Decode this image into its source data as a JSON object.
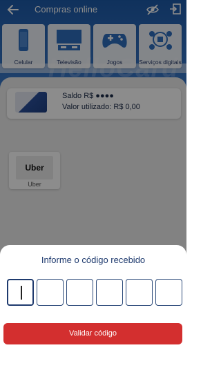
{
  "header": {
    "title": "Compras online",
    "back_icon": "arrow-left-icon",
    "hide_balance_icon": "eye-off-icon",
    "exit_icon": "logout-icon"
  },
  "hero": {
    "watermark": "HelloCard"
  },
  "categories": [
    {
      "label": "Celular",
      "icon": "smartphone-icon"
    },
    {
      "label": "Televisão",
      "icon": "tv-icon"
    },
    {
      "label": "Jogos",
      "icon": "gamepad-icon"
    },
    {
      "label": "Serviços digitais",
      "icon": "digital-services-icon"
    }
  ],
  "balance": {
    "saldo_label": "Saldo R$ ●●●●",
    "used_label": "Valor utilizado: R$ 0,00"
  },
  "merchants": [
    {
      "logo_text": "Uber",
      "name": "Uber"
    }
  ],
  "code_sheet": {
    "title": "Informe o código recebido",
    "digits": [
      "",
      "",
      "",
      "",
      "",
      ""
    ],
    "button_label": "Validar código"
  },
  "colors": {
    "brand_blue": "#1d5aa8",
    "heading_navy": "#1e3a6e",
    "button_red": "#d32f2f"
  }
}
